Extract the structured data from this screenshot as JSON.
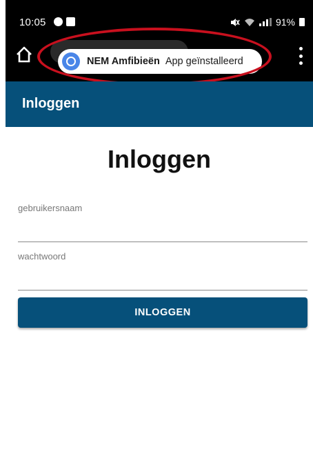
{
  "status_bar": {
    "time": "10:05",
    "battery_text": "91%",
    "icons": [
      "chrome-notification-icon",
      "gallery-notification-icon",
      "mute-icon",
      "wifi-icon",
      "signal-icon",
      "battery-icon"
    ]
  },
  "browser": {
    "toast": {
      "app_name": "NEM Amfibieën",
      "message": "App geïnstalleerd"
    },
    "icons": [
      "home-icon",
      "chrome-icon",
      "overflow-menu-icon"
    ]
  },
  "header": {
    "title": "Inloggen"
  },
  "login": {
    "heading": "Inloggen",
    "username_label": "gebruikersnaam",
    "username_value": "",
    "password_label": "wachtwoord",
    "password_value": "",
    "submit_label": "INLOGGEN"
  },
  "colors": {
    "brand_blue": "#06507a",
    "highlight_red": "#c8101e"
  }
}
